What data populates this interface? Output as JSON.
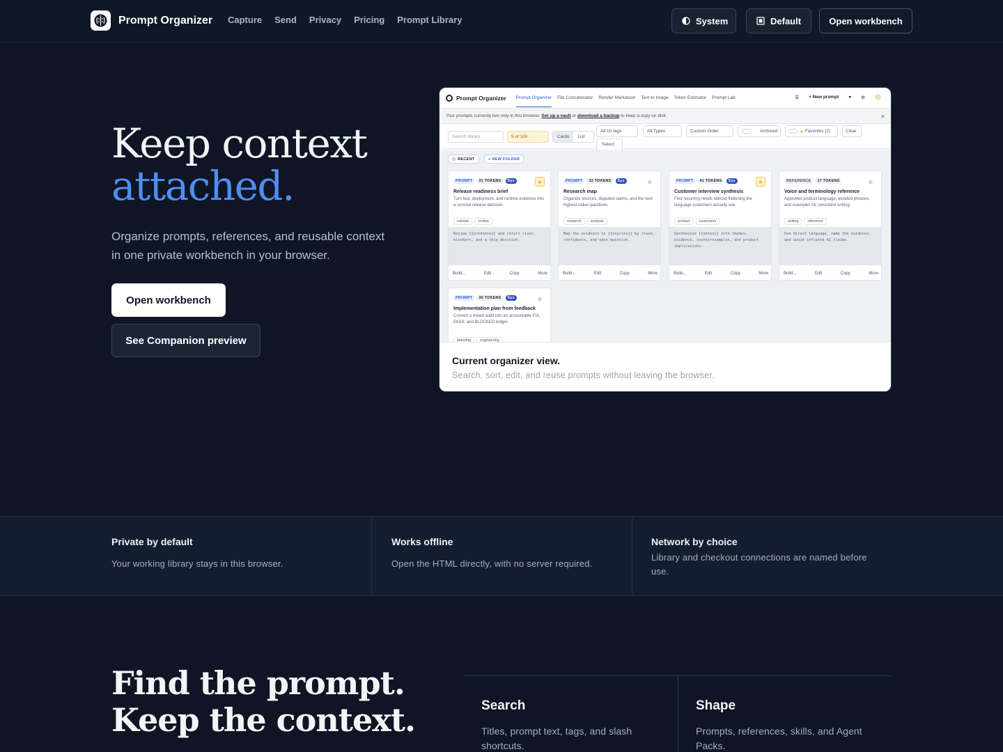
{
  "nav": {
    "brand": "Prompt Organizer",
    "links": [
      "Capture",
      "Send",
      "Privacy",
      "Pricing",
      "Prompt Library"
    ],
    "theme_label": "System",
    "style_label": "Default",
    "open_label": "Open workbench"
  },
  "hero": {
    "title_line1": "Keep context",
    "title_line2": "attached.",
    "subtitle": "Organize prompts, references, and reusable context in one private workbench in your browser.",
    "cta_primary": "Open workbench",
    "cta_secondary": "See Companion preview"
  },
  "preview": {
    "app_name": "Prompt Organizer",
    "tabs": [
      "Prompt Organizer",
      "File Concatenator",
      "Render Markdown",
      "Text to Image",
      "Token Estimator",
      "Prompt Lab"
    ],
    "new_prompt": "+ New prompt",
    "banner": {
      "text_a": "Your prompts currently live only in this browser.",
      "link_vault": "Set up a vault",
      "text_or": "or",
      "link_backup": "download a backup",
      "text_b": "to keep a copy on disk."
    },
    "filters": {
      "search_placeholder": "Search library",
      "count": "5 of 100",
      "view_cards": "Cards",
      "view_list": "List",
      "tags": "All 10 tags",
      "types": "All Types",
      "order": "Custom Order",
      "archived": "Archived",
      "favorites": "Favorites (2)",
      "clear": "Clear",
      "select": "Select"
    },
    "chip_recent": "RECENT",
    "chip_new_folder": "+ NEW FOLDER",
    "cards": [
      {
        "type": "PROMPT",
        "tokens": "31 TOKENS",
        "sys": "Sys",
        "title": "Release readiness brief",
        "desc": "Turn test, deployment, and runtime evidence into a concise release decision.",
        "tags": [
          "release",
          "review"
        ],
        "code": "Review {{evidence}} and return risks, blockers, and a ship decision."
      },
      {
        "type": "PROMPT",
        "tokens": "32 TOKENS",
        "sys": "Sys",
        "title": "Research map",
        "desc": "Organize sources, disputed claims, and the next highest-value questions.",
        "tags": [
          "research",
          "analysis"
        ],
        "code": "Map the evidence in {{sources}} by claim, confidence, and open question."
      },
      {
        "type": "PROMPT",
        "tokens": "41 TOKENS",
        "sys": "Sys",
        "title": "Customer interview synthesis",
        "desc": "Find recurring needs without flattening the language customers actually use.",
        "tags": [
          "product",
          "customers"
        ],
        "code": "Synthesize {{notes}} into themes, evidence, counterexamples, and product implications."
      },
      {
        "type": "REFERENCE",
        "tokens": "17 TOKENS",
        "sys": "",
        "title": "Voice and terminology reference",
        "desc": "Approved product language, avoided phrases, and examples for consistent writing.",
        "tags": [
          "writing",
          "reference"
        ],
        "code": "Use direct language, name the evidence, and avoid inflated AI claims."
      },
      {
        "type": "PROMPT",
        "tokens": "30 TOKENS",
        "sys": "Sys",
        "title": "Implementation plan from feedback",
        "desc": "Convert a mixed audit into an accountable FIX, PASS, and BLOCKED ledger.",
        "tags": [
          "planning",
          "engineering"
        ],
        "code": ""
      }
    ],
    "actions": {
      "build": "Build...",
      "edit": "Edit",
      "copy": "Copy",
      "more": "More"
    },
    "caption_title": "Current organizer view.",
    "caption_sub": "Search, sort, edit, and reuse prompts without leaving the browser."
  },
  "features": [
    {
      "title": "Private by default",
      "body": "Your working library stays in this browser."
    },
    {
      "title": "Works offline",
      "body": "Open the HTML directly, with no server required."
    },
    {
      "title": "Network by choice",
      "body": "Library and checkout connections are named before use."
    }
  ],
  "section2": {
    "title": "Find the prompt. Keep the context.",
    "items": [
      {
        "title": "Search",
        "body": "Titles, prompt text, tags, and slash shortcuts."
      },
      {
        "title": "Shape",
        "body": "Prompts, references, skills, and Agent Packs."
      }
    ]
  }
}
